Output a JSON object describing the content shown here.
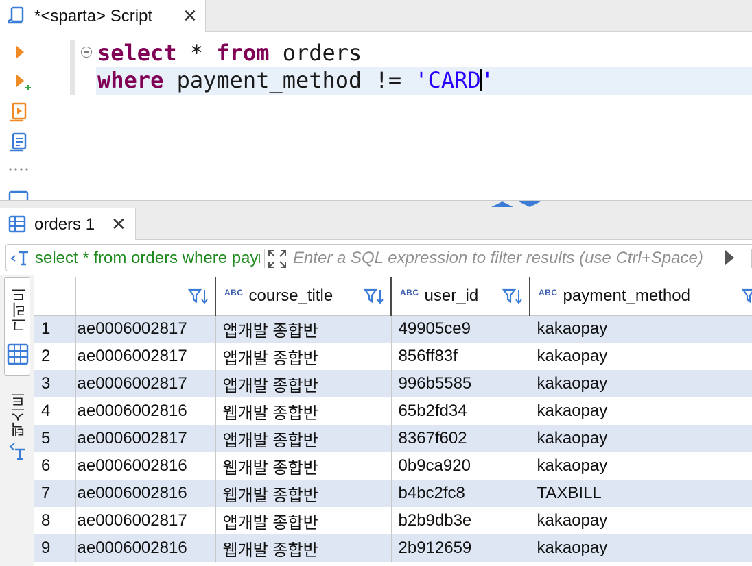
{
  "editor_tab": {
    "title": "*<sparta> Script",
    "close": "✕"
  },
  "editor": {
    "line1": {
      "kw1": "select",
      "rest1": " * ",
      "kw2": "from",
      "rest2": " orders"
    },
    "line2": {
      "kw1": "where",
      "rest1": " payment_method != ",
      "str_before_caret": "'CARD",
      "str_after_caret": "'"
    }
  },
  "results_tab": {
    "title": "orders 1",
    "close": "✕"
  },
  "filter": {
    "query_text": "select * from orders where payment_method != 'CARD'",
    "placeholder": "Enter a SQL expression to filter results (use Ctrl+Space)"
  },
  "side_tabs": {
    "grid": "그리드",
    "text": "텍스트"
  },
  "grid": {
    "columns": [
      {
        "name": "",
        "type_badge": ""
      },
      {
        "name": "course_title",
        "type_badge": "ABC"
      },
      {
        "name": "user_id",
        "type_badge": "ABC"
      },
      {
        "name": "payment_method",
        "type_badge": "ABC"
      }
    ],
    "rows": [
      {
        "n": "1",
        "c0": "ae0006002817",
        "course_title": "앱개발 종합반",
        "user_id": "49905ce9",
        "payment_method": "kakaopay"
      },
      {
        "n": "2",
        "c0": "ae0006002817",
        "course_title": "앱개발 종합반",
        "user_id": "856ff83f",
        "payment_method": "kakaopay"
      },
      {
        "n": "3",
        "c0": "ae0006002817",
        "course_title": "앱개발 종합반",
        "user_id": "996b5585",
        "payment_method": "kakaopay"
      },
      {
        "n": "4",
        "c0": "ae0006002816",
        "course_title": "웹개발 종합반",
        "user_id": "65b2fd34",
        "payment_method": "kakaopay"
      },
      {
        "n": "5",
        "c0": "ae0006002817",
        "course_title": "앱개발 종합반",
        "user_id": "8367f602",
        "payment_method": "kakaopay"
      },
      {
        "n": "6",
        "c0": "ae0006002816",
        "course_title": "웹개발 종합반",
        "user_id": "0b9ca920",
        "payment_method": "kakaopay"
      },
      {
        "n": "7",
        "c0": "ae0006002816",
        "course_title": "웹개발 종합반",
        "user_id": "b4bc2fc8",
        "payment_method": "TAXBILL"
      },
      {
        "n": "8",
        "c0": "ae0006002817",
        "course_title": "앱개발 종합반",
        "user_id": "b2b9db3e",
        "payment_method": "kakaopay"
      },
      {
        "n": "9",
        "c0": "ae0006002816",
        "course_title": "웹개발 종합반",
        "user_id": "2b912659",
        "payment_method": "kakaopay"
      }
    ]
  },
  "icons": {
    "script_tab": "script-icon",
    "execute": "execute-statement-icon",
    "execute_new_tab": "execute-in-new-tab-icon",
    "execute_script": "execute-script-icon",
    "explain": "explain-plan-icon",
    "results_tab": "table-grid-icon",
    "filter_history": "filter-history-icon",
    "expand_filter": "expand-filter-icon",
    "column_filter": "column-filter-sort-icon"
  },
  "colors": {
    "keyword": "#7f0055",
    "string": "#2a00ff",
    "filter_query": "#1e8a1e",
    "alt_row": "#dde6f2",
    "icon_blue": "#3b7cd6",
    "run_orange": "#f08a24"
  }
}
